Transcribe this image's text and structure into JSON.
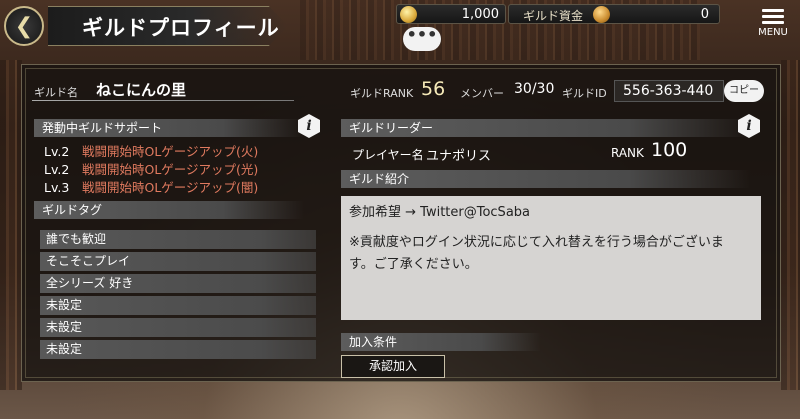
{
  "header": {
    "title": "ギルドプロフィール",
    "menu_label": "MENU",
    "chat_icon_text": "•••"
  },
  "currency": {
    "gold_value": "1,000",
    "guild_funds_label": "ギルド資金",
    "guild_funds_value": "0"
  },
  "guild": {
    "name_label": "ギルド名",
    "name": "ねこにんの里",
    "rank_label": "ギルドRANK",
    "rank": "56",
    "member_label": "メンバー",
    "members": "30/30",
    "id_label": "ギルドID",
    "id": "556-363-440",
    "copy_label": "コピー"
  },
  "support": {
    "header": "発動中ギルドサポート",
    "items": [
      {
        "level": "Lv.2",
        "name": "戦闘開始時OLゲージアップ(火)"
      },
      {
        "level": "Lv.2",
        "name": "戦闘開始時OLゲージアップ(光)"
      },
      {
        "level": "Lv.3",
        "name": "戦闘開始時OLゲージアップ(闇)"
      }
    ]
  },
  "tags": {
    "header": "ギルドタグ",
    "items": [
      "誰でも歓迎",
      "そこそこプレイ",
      "全シリーズ 好き",
      "未設定",
      "未設定",
      "未設定"
    ]
  },
  "leader": {
    "header": "ギルドリーダー",
    "player_label": "プレイヤー名",
    "player_name": "ユナポリス",
    "rank_label": "RANK",
    "rank": "100"
  },
  "intro": {
    "header": "ギルド紹介",
    "line1": "参加希望 → Twitter@TocSaba",
    "line2": "※貢献度やログイン状況に応じて入れ替えを行う場合がございま",
    "line3": "す。ご了承ください。"
  },
  "join": {
    "header": "加入条件",
    "condition": "承認加入"
  },
  "colors": {
    "support_name": "#e07a5f",
    "gold_coin": "#d9a83a",
    "funds_coin": "#c98b2e"
  }
}
